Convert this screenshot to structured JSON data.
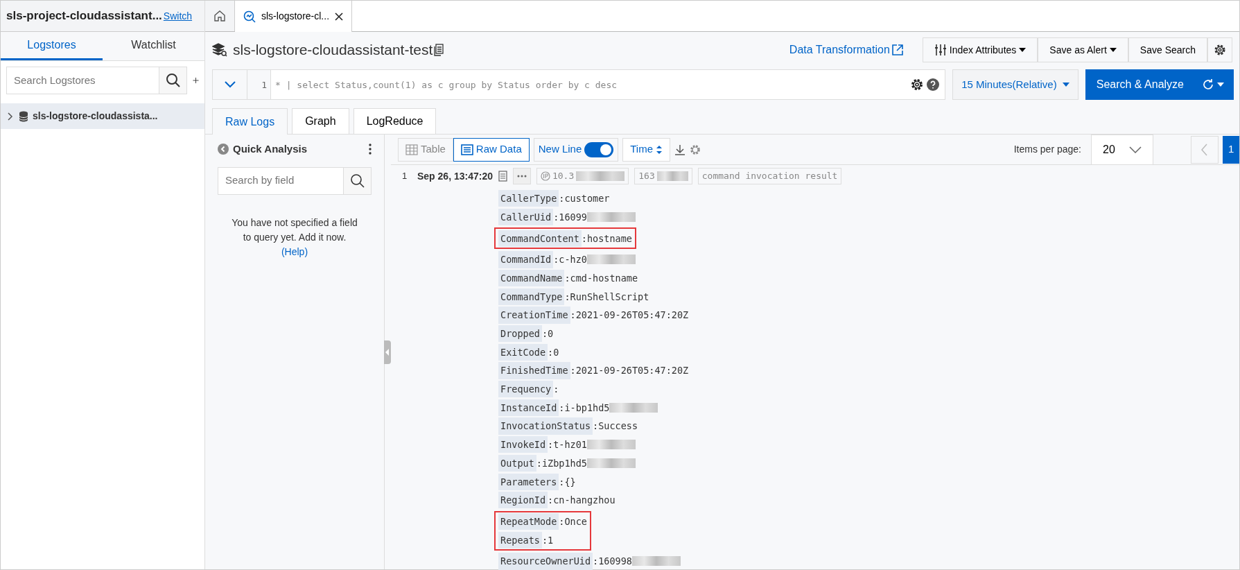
{
  "project": {
    "title": "sls-project-cloudassistant...",
    "switch_link": "Switch"
  },
  "top_tabs": [
    {
      "kind": "home",
      "selected": false
    },
    {
      "kind": "logstore",
      "label": "sls-logstore-cl...",
      "selected": true
    }
  ],
  "sidebar": {
    "tabs": [
      {
        "label": "Logstores",
        "selected": true
      },
      {
        "label": "Watchlist",
        "selected": false
      }
    ],
    "search": {
      "placeholder": "Search Logstores"
    },
    "items": [
      {
        "label": "sls-logstore-cloudassista...",
        "expanded": false,
        "selected": true
      }
    ]
  },
  "header": {
    "title": "sls-logstore-cloudassistant-test",
    "data_transformation": "Data Transformation",
    "buttons": [
      {
        "kind": "index",
        "label": "Index Attributes"
      },
      {
        "kind": "dropdown",
        "label": "Save as Alert"
      },
      {
        "kind": "plain",
        "label": "Save Search"
      },
      {
        "kind": "gear"
      }
    ]
  },
  "query": {
    "line_number": "1",
    "text": "* | select Status,count(1) as c group by Status order by c desc",
    "time_range": "15 Minutes(Relative)",
    "search_button": "Search & Analyze"
  },
  "view_tabs": [
    {
      "label": "Raw Logs",
      "selected": true
    },
    {
      "label": "Graph",
      "selected": false
    },
    {
      "label": "LogReduce",
      "selected": false
    }
  ],
  "quick_analysis": {
    "title": "Quick Analysis",
    "search": {
      "placeholder": "Search by field"
    },
    "message": "You have not specified a field to query yet. Add it now.",
    "help_link": "(Help)"
  },
  "toolbar": {
    "view_modes": [
      {
        "kind": "table",
        "label": "Table",
        "selected": false
      },
      {
        "kind": "raw",
        "label": "Raw Data",
        "selected": true
      }
    ],
    "new_line": {
      "label": "New Line",
      "on": true
    },
    "sort": "Time",
    "items_per_page_label": "Items per page:",
    "items_per_page": "20",
    "page": "1"
  },
  "log": {
    "index": "1",
    "time": "Sep 26, 13:47:20",
    "ip": "10.3",
    "source": "163",
    "topic": "command invocation result",
    "groups": [
      {
        "highlighted": false,
        "fields": [
          {
            "key": "CallerType",
            "value": ":customer"
          },
          {
            "key": "CallerUid",
            "value": ":16099",
            "redacted": true
          }
        ]
      },
      {
        "highlighted": true,
        "fields": [
          {
            "key": "CommandContent",
            "value": ":hostname"
          }
        ]
      },
      {
        "highlighted": false,
        "fields": [
          {
            "key": "CommandId",
            "value": ":c-hz0",
            "redacted": true
          },
          {
            "key": "CommandName",
            "value": ":cmd-hostname"
          },
          {
            "key": "CommandType",
            "value": ":RunShellScript"
          },
          {
            "key": "CreationTime",
            "value": ":2021-09-26T05:47:20Z"
          },
          {
            "key": "Dropped",
            "value": ":0"
          },
          {
            "key": "ExitCode",
            "value": ":0"
          },
          {
            "key": "FinishedTime",
            "value": ":2021-09-26T05:47:20Z"
          },
          {
            "key": "Frequency",
            "value": ":"
          },
          {
            "key": "InstanceId",
            "value": ":i-bp1hd5",
            "redacted": true
          },
          {
            "key": "InvocationStatus",
            "value": ":Success"
          },
          {
            "key": "InvokeId",
            "value": ":t-hz01",
            "redacted": true
          },
          {
            "key": "Output",
            "value": ":iZbp1hd5",
            "redacted": true
          },
          {
            "key": "Parameters",
            "value": ":{}"
          },
          {
            "key": "RegionId",
            "value": ":cn-hangzhou"
          }
        ]
      },
      {
        "highlighted": true,
        "fields": [
          {
            "key": "RepeatMode",
            "value": ":Once"
          },
          {
            "key": "Repeats",
            "value": ":1"
          }
        ]
      },
      {
        "highlighted": false,
        "fields": [
          {
            "key": "ResourceOwnerUid",
            "value": ":160998",
            "redacted": true
          }
        ]
      }
    ]
  }
}
